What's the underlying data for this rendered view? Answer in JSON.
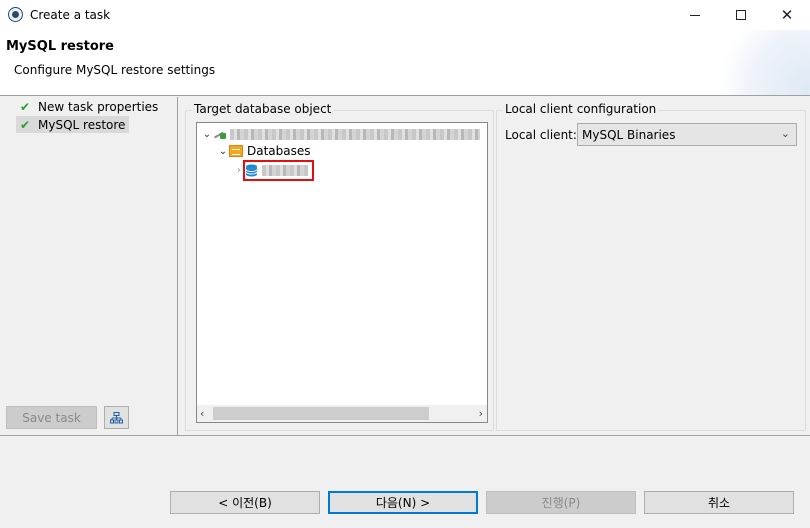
{
  "window": {
    "title": "Create a task",
    "minimize": "minimize",
    "maximize": "maximize",
    "close": "close"
  },
  "header": {
    "title": "MySQL restore",
    "description": "Configure MySQL restore settings"
  },
  "nav": {
    "items": [
      {
        "label": "New task properties",
        "icon": "check-icon",
        "selected": false
      },
      {
        "label": "MySQL restore",
        "icon": "check-icon",
        "selected": true
      }
    ],
    "save_task": "Save task",
    "extra_icon": "sitemap-icon"
  },
  "target": {
    "group_title": "Target database object",
    "tree": {
      "databases_label": "Databases"
    }
  },
  "local": {
    "group_title": "Local client configuration",
    "client_label": "Local client:",
    "client_value": "MySQL Binaries"
  },
  "footer": {
    "back": "< 이전(B)",
    "next": "다음(N) >",
    "proceed": "진행(P)",
    "cancel": "취소"
  },
  "colors": {
    "accent": "#0078d7",
    "highlight": "#e01010",
    "check": "#2a9d2a",
    "folder": "#f5a623",
    "db": "#1e88d6"
  }
}
